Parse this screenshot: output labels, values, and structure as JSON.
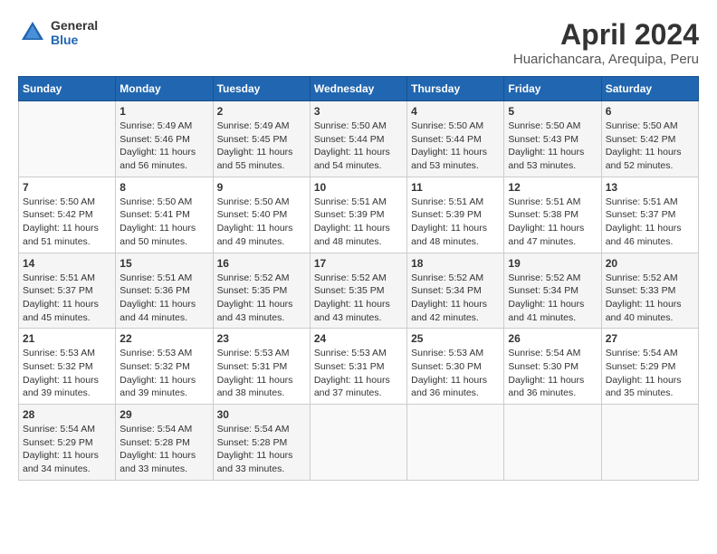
{
  "header": {
    "logo_general": "General",
    "logo_blue": "Blue",
    "title": "April 2024",
    "subtitle": "Huarichancara, Arequipa, Peru"
  },
  "days_of_week": [
    "Sunday",
    "Monday",
    "Tuesday",
    "Wednesday",
    "Thursday",
    "Friday",
    "Saturday"
  ],
  "weeks": [
    [
      {
        "day": "",
        "info": ""
      },
      {
        "day": "1",
        "info": "Sunrise: 5:49 AM\nSunset: 5:46 PM\nDaylight: 11 hours\nand 56 minutes."
      },
      {
        "day": "2",
        "info": "Sunrise: 5:49 AM\nSunset: 5:45 PM\nDaylight: 11 hours\nand 55 minutes."
      },
      {
        "day": "3",
        "info": "Sunrise: 5:50 AM\nSunset: 5:44 PM\nDaylight: 11 hours\nand 54 minutes."
      },
      {
        "day": "4",
        "info": "Sunrise: 5:50 AM\nSunset: 5:44 PM\nDaylight: 11 hours\nand 53 minutes."
      },
      {
        "day": "5",
        "info": "Sunrise: 5:50 AM\nSunset: 5:43 PM\nDaylight: 11 hours\nand 53 minutes."
      },
      {
        "day": "6",
        "info": "Sunrise: 5:50 AM\nSunset: 5:42 PM\nDaylight: 11 hours\nand 52 minutes."
      }
    ],
    [
      {
        "day": "7",
        "info": "Sunrise: 5:50 AM\nSunset: 5:42 PM\nDaylight: 11 hours\nand 51 minutes."
      },
      {
        "day": "8",
        "info": "Sunrise: 5:50 AM\nSunset: 5:41 PM\nDaylight: 11 hours\nand 50 minutes."
      },
      {
        "day": "9",
        "info": "Sunrise: 5:50 AM\nSunset: 5:40 PM\nDaylight: 11 hours\nand 49 minutes."
      },
      {
        "day": "10",
        "info": "Sunrise: 5:51 AM\nSunset: 5:39 PM\nDaylight: 11 hours\nand 48 minutes."
      },
      {
        "day": "11",
        "info": "Sunrise: 5:51 AM\nSunset: 5:39 PM\nDaylight: 11 hours\nand 48 minutes."
      },
      {
        "day": "12",
        "info": "Sunrise: 5:51 AM\nSunset: 5:38 PM\nDaylight: 11 hours\nand 47 minutes."
      },
      {
        "day": "13",
        "info": "Sunrise: 5:51 AM\nSunset: 5:37 PM\nDaylight: 11 hours\nand 46 minutes."
      }
    ],
    [
      {
        "day": "14",
        "info": "Sunrise: 5:51 AM\nSunset: 5:37 PM\nDaylight: 11 hours\nand 45 minutes."
      },
      {
        "day": "15",
        "info": "Sunrise: 5:51 AM\nSunset: 5:36 PM\nDaylight: 11 hours\nand 44 minutes."
      },
      {
        "day": "16",
        "info": "Sunrise: 5:52 AM\nSunset: 5:35 PM\nDaylight: 11 hours\nand 43 minutes."
      },
      {
        "day": "17",
        "info": "Sunrise: 5:52 AM\nSunset: 5:35 PM\nDaylight: 11 hours\nand 43 minutes."
      },
      {
        "day": "18",
        "info": "Sunrise: 5:52 AM\nSunset: 5:34 PM\nDaylight: 11 hours\nand 42 minutes."
      },
      {
        "day": "19",
        "info": "Sunrise: 5:52 AM\nSunset: 5:34 PM\nDaylight: 11 hours\nand 41 minutes."
      },
      {
        "day": "20",
        "info": "Sunrise: 5:52 AM\nSunset: 5:33 PM\nDaylight: 11 hours\nand 40 minutes."
      }
    ],
    [
      {
        "day": "21",
        "info": "Sunrise: 5:53 AM\nSunset: 5:32 PM\nDaylight: 11 hours\nand 39 minutes."
      },
      {
        "day": "22",
        "info": "Sunrise: 5:53 AM\nSunset: 5:32 PM\nDaylight: 11 hours\nand 39 minutes."
      },
      {
        "day": "23",
        "info": "Sunrise: 5:53 AM\nSunset: 5:31 PM\nDaylight: 11 hours\nand 38 minutes."
      },
      {
        "day": "24",
        "info": "Sunrise: 5:53 AM\nSunset: 5:31 PM\nDaylight: 11 hours\nand 37 minutes."
      },
      {
        "day": "25",
        "info": "Sunrise: 5:53 AM\nSunset: 5:30 PM\nDaylight: 11 hours\nand 36 minutes."
      },
      {
        "day": "26",
        "info": "Sunrise: 5:54 AM\nSunset: 5:30 PM\nDaylight: 11 hours\nand 36 minutes."
      },
      {
        "day": "27",
        "info": "Sunrise: 5:54 AM\nSunset: 5:29 PM\nDaylight: 11 hours\nand 35 minutes."
      }
    ],
    [
      {
        "day": "28",
        "info": "Sunrise: 5:54 AM\nSunset: 5:29 PM\nDaylight: 11 hours\nand 34 minutes."
      },
      {
        "day": "29",
        "info": "Sunrise: 5:54 AM\nSunset: 5:28 PM\nDaylight: 11 hours\nand 33 minutes."
      },
      {
        "day": "30",
        "info": "Sunrise: 5:54 AM\nSunset: 5:28 PM\nDaylight: 11 hours\nand 33 minutes."
      },
      {
        "day": "",
        "info": ""
      },
      {
        "day": "",
        "info": ""
      },
      {
        "day": "",
        "info": ""
      },
      {
        "day": "",
        "info": ""
      }
    ]
  ]
}
